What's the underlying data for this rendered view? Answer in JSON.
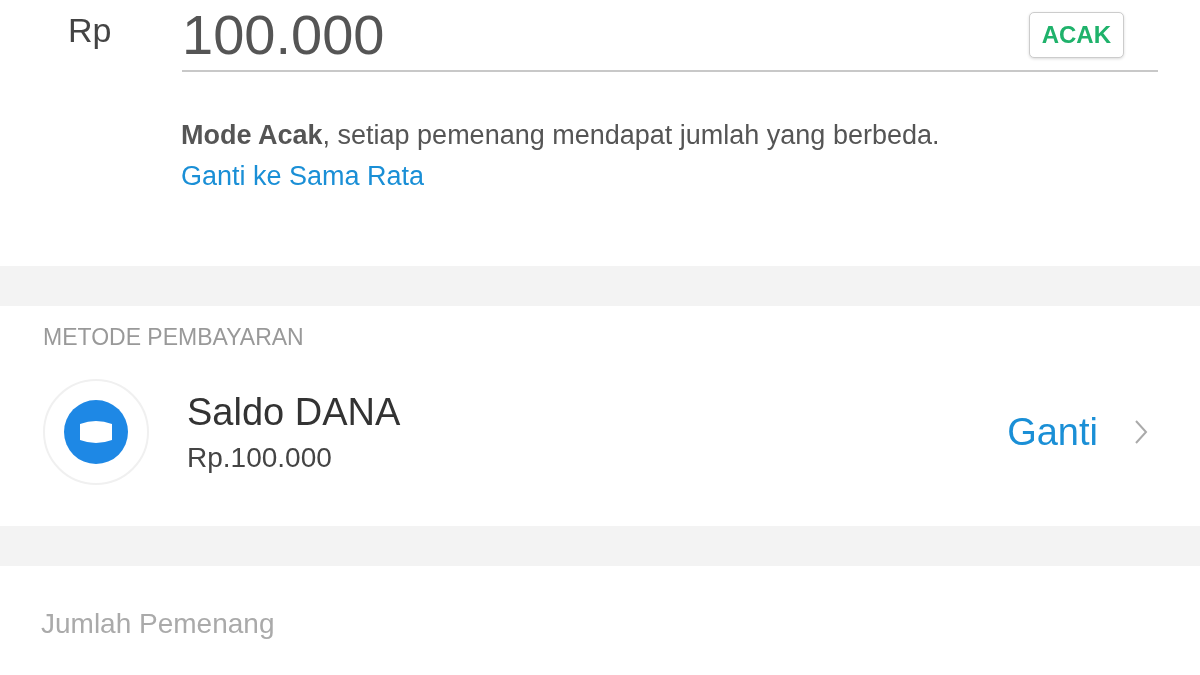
{
  "amount": {
    "currency": "Rp",
    "value": "100.000",
    "mode_badge": "ACAK"
  },
  "mode_note": {
    "text": "**Mode Acak**, setiap pemenang mendapat jumlah yang berbeda.",
    "link": "Ganti ke Sama Rata"
  },
  "payment": {
    "heading": "METODE PEMBAYARAN",
    "method": "Saldo DANA",
    "balance": "Rp.100.000",
    "change_button": "Ganti"
  },
  "winners": {
    "label": "Jumlah Pemenang"
  }
}
